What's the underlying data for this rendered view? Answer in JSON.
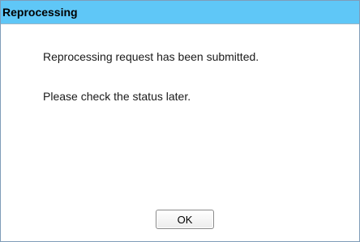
{
  "dialog": {
    "title": "Reprocessing",
    "messages": [
      "Reprocessing request has been submitted.",
      "Please check the status later."
    ],
    "ok_label": "OK"
  }
}
